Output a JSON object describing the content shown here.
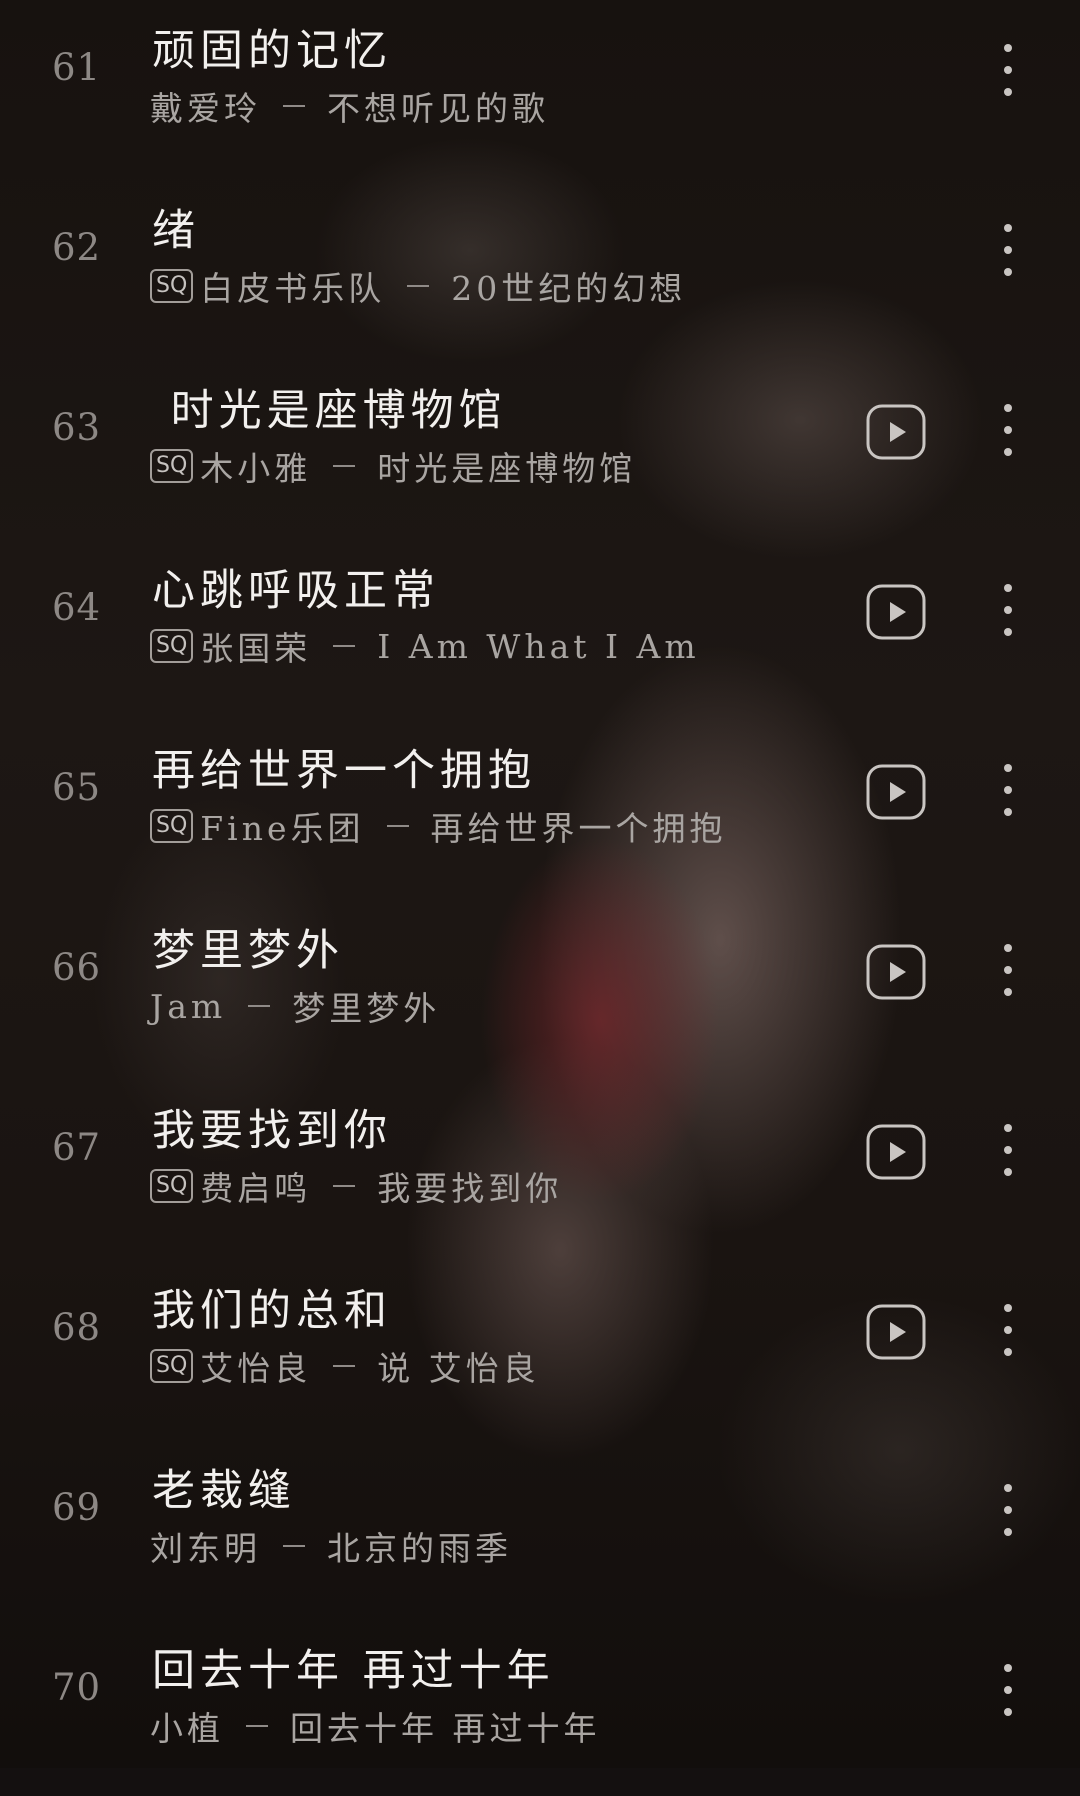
{
  "songs": [
    {
      "num": "61",
      "title": "顽固的记忆",
      "sq": "",
      "artist": "戴爱玲",
      "album": "不想听见的歌",
      "has_play": false
    },
    {
      "num": "62",
      "title": "绪",
      "sq": "SQ",
      "artist": "白皮书乐队",
      "album": "20世纪的幻想",
      "has_play": false
    },
    {
      "num": "63",
      "title": " 时光是座博物馆",
      "sq": "SQ",
      "artist": "木小雅",
      "album": "时光是座博物馆",
      "has_play": true
    },
    {
      "num": "64",
      "title": "心跳呼吸正常",
      "sq": "SQ",
      "artist": "张国荣",
      "album": "I Am What I Am",
      "has_play": true
    },
    {
      "num": "65",
      "title": "再给世界一个拥抱",
      "sq": "SQ",
      "artist": "Fine乐团",
      "album": "再给世界一个拥抱",
      "has_play": true
    },
    {
      "num": "66",
      "title": "梦里梦外",
      "sq": "",
      "artist": "Jam",
      "album": "梦里梦外",
      "has_play": true
    },
    {
      "num": "67",
      "title": "我要找到你",
      "sq": "SQ",
      "artist": "费启鸣",
      "album": "我要找到你",
      "has_play": true
    },
    {
      "num": "68",
      "title": "我们的总和",
      "sq": "SQ",
      "artist": "艾怡良",
      "album": "说 艾怡良",
      "has_play": true
    },
    {
      "num": "69",
      "title": "老裁缝",
      "sq": "",
      "artist": "刘东明",
      "album": "北京的雨季",
      "has_play": false
    },
    {
      "num": "70",
      "title": "回去十年 再过十年",
      "sq": "",
      "artist": "小植",
      "album": "回去十年 再过十年",
      "has_play": false
    }
  ],
  "icons": {
    "play": "play-circle-icon",
    "more": "more-vertical-icon"
  },
  "colors": {
    "title": "#f2f0ee",
    "subtitle": "#a9a5a2",
    "index": "#8d8885",
    "icon": "#c9c5c2"
  }
}
